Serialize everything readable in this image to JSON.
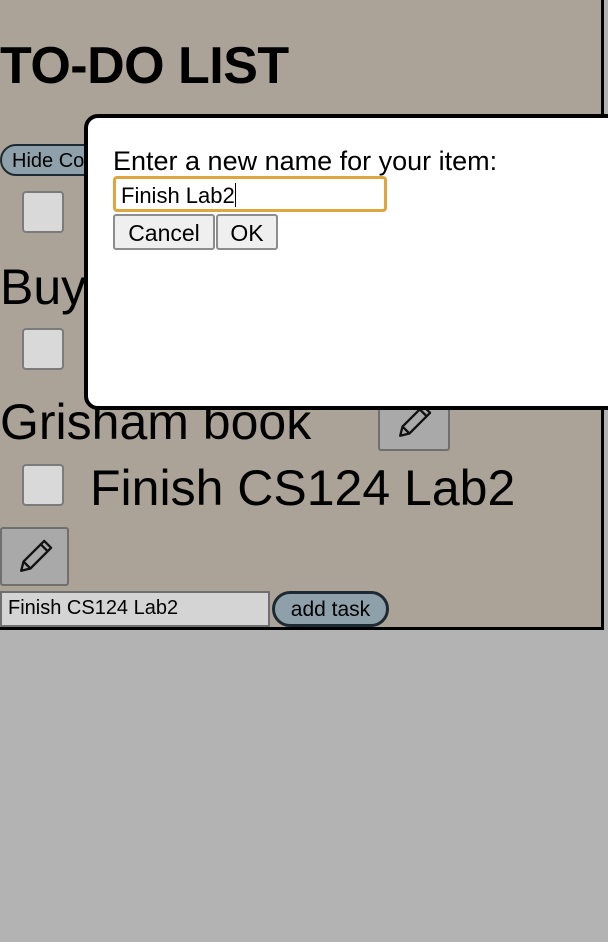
{
  "app": {
    "title": "TO-DO LIST",
    "hide_button_label": "Hide Completed",
    "tasks": [
      {
        "label": "Buy Bananas"
      },
      {
        "label": "Grisham book"
      },
      {
        "label": "Finish CS124 Lab2"
      }
    ],
    "new_task": {
      "value": "Finish CS124 Lab2",
      "button_label": "add task"
    }
  },
  "dialog": {
    "message": "Enter a new name for your item:",
    "input_value": "Finish Lab2",
    "cancel_label": "Cancel",
    "ok_label": "OK"
  },
  "colors": {
    "app_background": "#aba398",
    "page_background": "#b3b3b3",
    "button_accent": "#8ea1aa",
    "input_focus": "#e0a53f"
  },
  "icons": {
    "edit": "pencil-icon"
  }
}
